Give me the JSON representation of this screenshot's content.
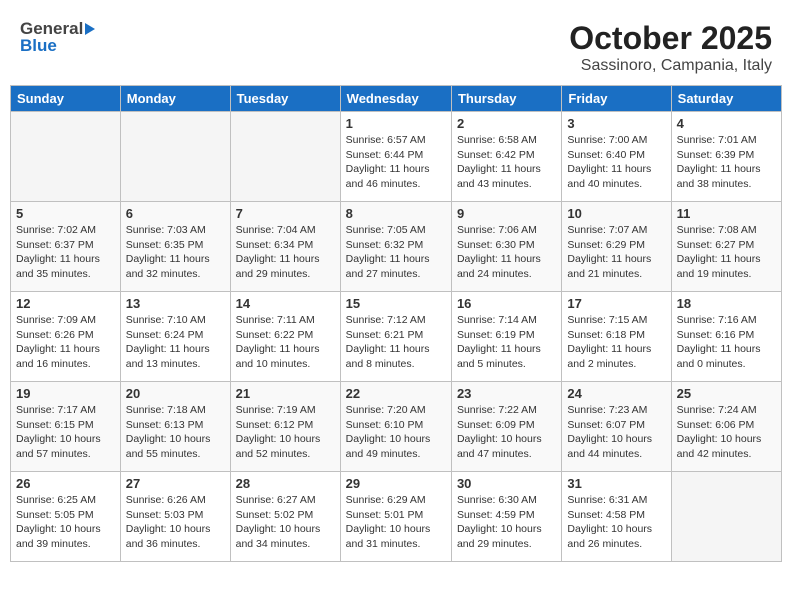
{
  "header": {
    "logo_general": "General",
    "logo_blue": "Blue",
    "month": "October 2025",
    "location": "Sassinoro, Campania, Italy"
  },
  "weekdays": [
    "Sunday",
    "Monday",
    "Tuesday",
    "Wednesday",
    "Thursday",
    "Friday",
    "Saturday"
  ],
  "weeks": [
    [
      {
        "day": "",
        "info": ""
      },
      {
        "day": "",
        "info": ""
      },
      {
        "day": "",
        "info": ""
      },
      {
        "day": "1",
        "info": "Sunrise: 6:57 AM\nSunset: 6:44 PM\nDaylight: 11 hours and 46 minutes."
      },
      {
        "day": "2",
        "info": "Sunrise: 6:58 AM\nSunset: 6:42 PM\nDaylight: 11 hours and 43 minutes."
      },
      {
        "day": "3",
        "info": "Sunrise: 7:00 AM\nSunset: 6:40 PM\nDaylight: 11 hours and 40 minutes."
      },
      {
        "day": "4",
        "info": "Sunrise: 7:01 AM\nSunset: 6:39 PM\nDaylight: 11 hours and 38 minutes."
      }
    ],
    [
      {
        "day": "5",
        "info": "Sunrise: 7:02 AM\nSunset: 6:37 PM\nDaylight: 11 hours and 35 minutes."
      },
      {
        "day": "6",
        "info": "Sunrise: 7:03 AM\nSunset: 6:35 PM\nDaylight: 11 hours and 32 minutes."
      },
      {
        "day": "7",
        "info": "Sunrise: 7:04 AM\nSunset: 6:34 PM\nDaylight: 11 hours and 29 minutes."
      },
      {
        "day": "8",
        "info": "Sunrise: 7:05 AM\nSunset: 6:32 PM\nDaylight: 11 hours and 27 minutes."
      },
      {
        "day": "9",
        "info": "Sunrise: 7:06 AM\nSunset: 6:30 PM\nDaylight: 11 hours and 24 minutes."
      },
      {
        "day": "10",
        "info": "Sunrise: 7:07 AM\nSunset: 6:29 PM\nDaylight: 11 hours and 21 minutes."
      },
      {
        "day": "11",
        "info": "Sunrise: 7:08 AM\nSunset: 6:27 PM\nDaylight: 11 hours and 19 minutes."
      }
    ],
    [
      {
        "day": "12",
        "info": "Sunrise: 7:09 AM\nSunset: 6:26 PM\nDaylight: 11 hours and 16 minutes."
      },
      {
        "day": "13",
        "info": "Sunrise: 7:10 AM\nSunset: 6:24 PM\nDaylight: 11 hours and 13 minutes."
      },
      {
        "day": "14",
        "info": "Sunrise: 7:11 AM\nSunset: 6:22 PM\nDaylight: 11 hours and 10 minutes."
      },
      {
        "day": "15",
        "info": "Sunrise: 7:12 AM\nSunset: 6:21 PM\nDaylight: 11 hours and 8 minutes."
      },
      {
        "day": "16",
        "info": "Sunrise: 7:14 AM\nSunset: 6:19 PM\nDaylight: 11 hours and 5 minutes."
      },
      {
        "day": "17",
        "info": "Sunrise: 7:15 AM\nSunset: 6:18 PM\nDaylight: 11 hours and 2 minutes."
      },
      {
        "day": "18",
        "info": "Sunrise: 7:16 AM\nSunset: 6:16 PM\nDaylight: 11 hours and 0 minutes."
      }
    ],
    [
      {
        "day": "19",
        "info": "Sunrise: 7:17 AM\nSunset: 6:15 PM\nDaylight: 10 hours and 57 minutes."
      },
      {
        "day": "20",
        "info": "Sunrise: 7:18 AM\nSunset: 6:13 PM\nDaylight: 10 hours and 55 minutes."
      },
      {
        "day": "21",
        "info": "Sunrise: 7:19 AM\nSunset: 6:12 PM\nDaylight: 10 hours and 52 minutes."
      },
      {
        "day": "22",
        "info": "Sunrise: 7:20 AM\nSunset: 6:10 PM\nDaylight: 10 hours and 49 minutes."
      },
      {
        "day": "23",
        "info": "Sunrise: 7:22 AM\nSunset: 6:09 PM\nDaylight: 10 hours and 47 minutes."
      },
      {
        "day": "24",
        "info": "Sunrise: 7:23 AM\nSunset: 6:07 PM\nDaylight: 10 hours and 44 minutes."
      },
      {
        "day": "25",
        "info": "Sunrise: 7:24 AM\nSunset: 6:06 PM\nDaylight: 10 hours and 42 minutes."
      }
    ],
    [
      {
        "day": "26",
        "info": "Sunrise: 6:25 AM\nSunset: 5:05 PM\nDaylight: 10 hours and 39 minutes."
      },
      {
        "day": "27",
        "info": "Sunrise: 6:26 AM\nSunset: 5:03 PM\nDaylight: 10 hours and 36 minutes."
      },
      {
        "day": "28",
        "info": "Sunrise: 6:27 AM\nSunset: 5:02 PM\nDaylight: 10 hours and 34 minutes."
      },
      {
        "day": "29",
        "info": "Sunrise: 6:29 AM\nSunset: 5:01 PM\nDaylight: 10 hours and 31 minutes."
      },
      {
        "day": "30",
        "info": "Sunrise: 6:30 AM\nSunset: 4:59 PM\nDaylight: 10 hours and 29 minutes."
      },
      {
        "day": "31",
        "info": "Sunrise: 6:31 AM\nSunset: 4:58 PM\nDaylight: 10 hours and 26 minutes."
      },
      {
        "day": "",
        "info": ""
      }
    ]
  ]
}
